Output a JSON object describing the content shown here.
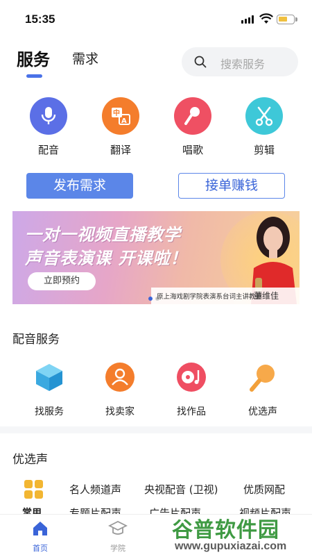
{
  "status_bar": {
    "time": "15:35"
  },
  "header": {
    "tabs": [
      {
        "label": "服务",
        "active": true
      },
      {
        "label": "需求",
        "active": false
      }
    ],
    "search": {
      "placeholder": "搜索服务"
    }
  },
  "categories": [
    {
      "label": "配音",
      "icon": "microphone-icon",
      "color": "#5b6fe6"
    },
    {
      "label": "翻译",
      "icon": "translate-icon",
      "color": "#f47d2c"
    },
    {
      "label": "唱歌",
      "icon": "karaoke-mic-icon",
      "color": "#ef5063"
    },
    {
      "label": "剪辑",
      "icon": "scissors-icon",
      "color": "#3ec8d8"
    }
  ],
  "actions": {
    "publish_label": "发布需求",
    "accept_label": "接单赚钱"
  },
  "banner": {
    "line1": "一对一视频直播教学",
    "line2": "声音表演课  开课啦！",
    "cta": "立即预约",
    "caption": "原上海戏剧学院表演系台词主讲教师",
    "caption_name": "董维佳"
  },
  "dubbing_services": {
    "title": "配音服务",
    "items": [
      {
        "label": "找服务",
        "icon": "cube-icon"
      },
      {
        "label": "找卖家",
        "icon": "person-icon"
      },
      {
        "label": "找作品",
        "icon": "music-disc-icon"
      },
      {
        "label": "优选声",
        "icon": "mic-icon"
      }
    ]
  },
  "preferred_voice": {
    "title": "优选声",
    "grid_label": "常用",
    "tabs": [
      "名人频道声",
      "央视配音 (卫视)",
      "优质网配"
    ],
    "peek_row": [
      "专题片配声",
      "广告片配声",
      "视频片配声"
    ]
  },
  "bottom_nav": [
    {
      "label": "首页",
      "icon": "home-icon",
      "active": true
    },
    {
      "label": "学院",
      "icon": "graduation-cap-icon",
      "active": false
    }
  ],
  "watermark": {
    "main": "谷普软件园",
    "url": "www.gupuxiazai.com"
  },
  "colors": {
    "accent": "#5b86e8",
    "active_nav": "#3a64d8",
    "inactive_nav": "#999999"
  }
}
